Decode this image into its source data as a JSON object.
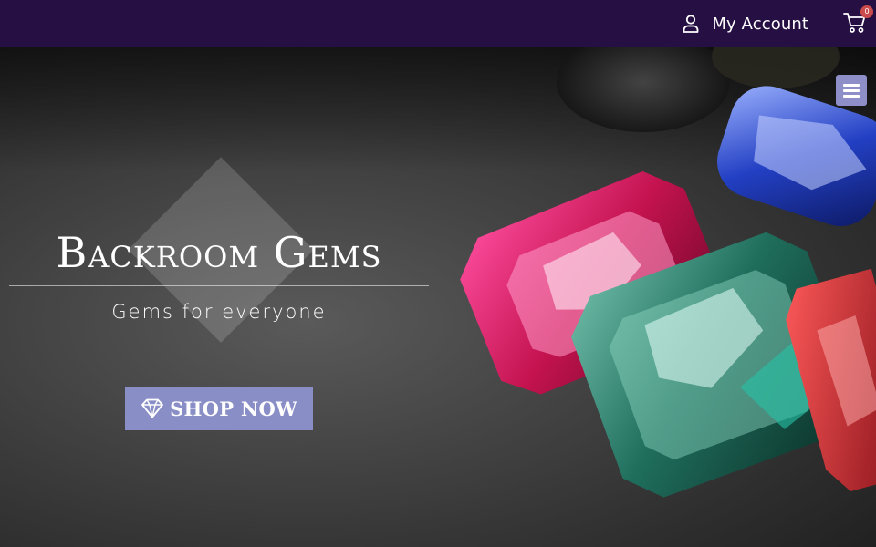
{
  "header": {
    "account_label": "My Account",
    "account_icon": "user-icon",
    "cart_icon": "cart-icon",
    "cart_count": "0",
    "background": "#261043"
  },
  "hero": {
    "title": "Backroom Gems",
    "tagline": "Gems for everyone",
    "cta_label": "SHOP NOW",
    "cta_icon": "diamond-icon",
    "cta_color": "#8a8ec6",
    "menu_icon": "hamburger-menu-icon",
    "image_description_icon": "gemstones-image"
  }
}
